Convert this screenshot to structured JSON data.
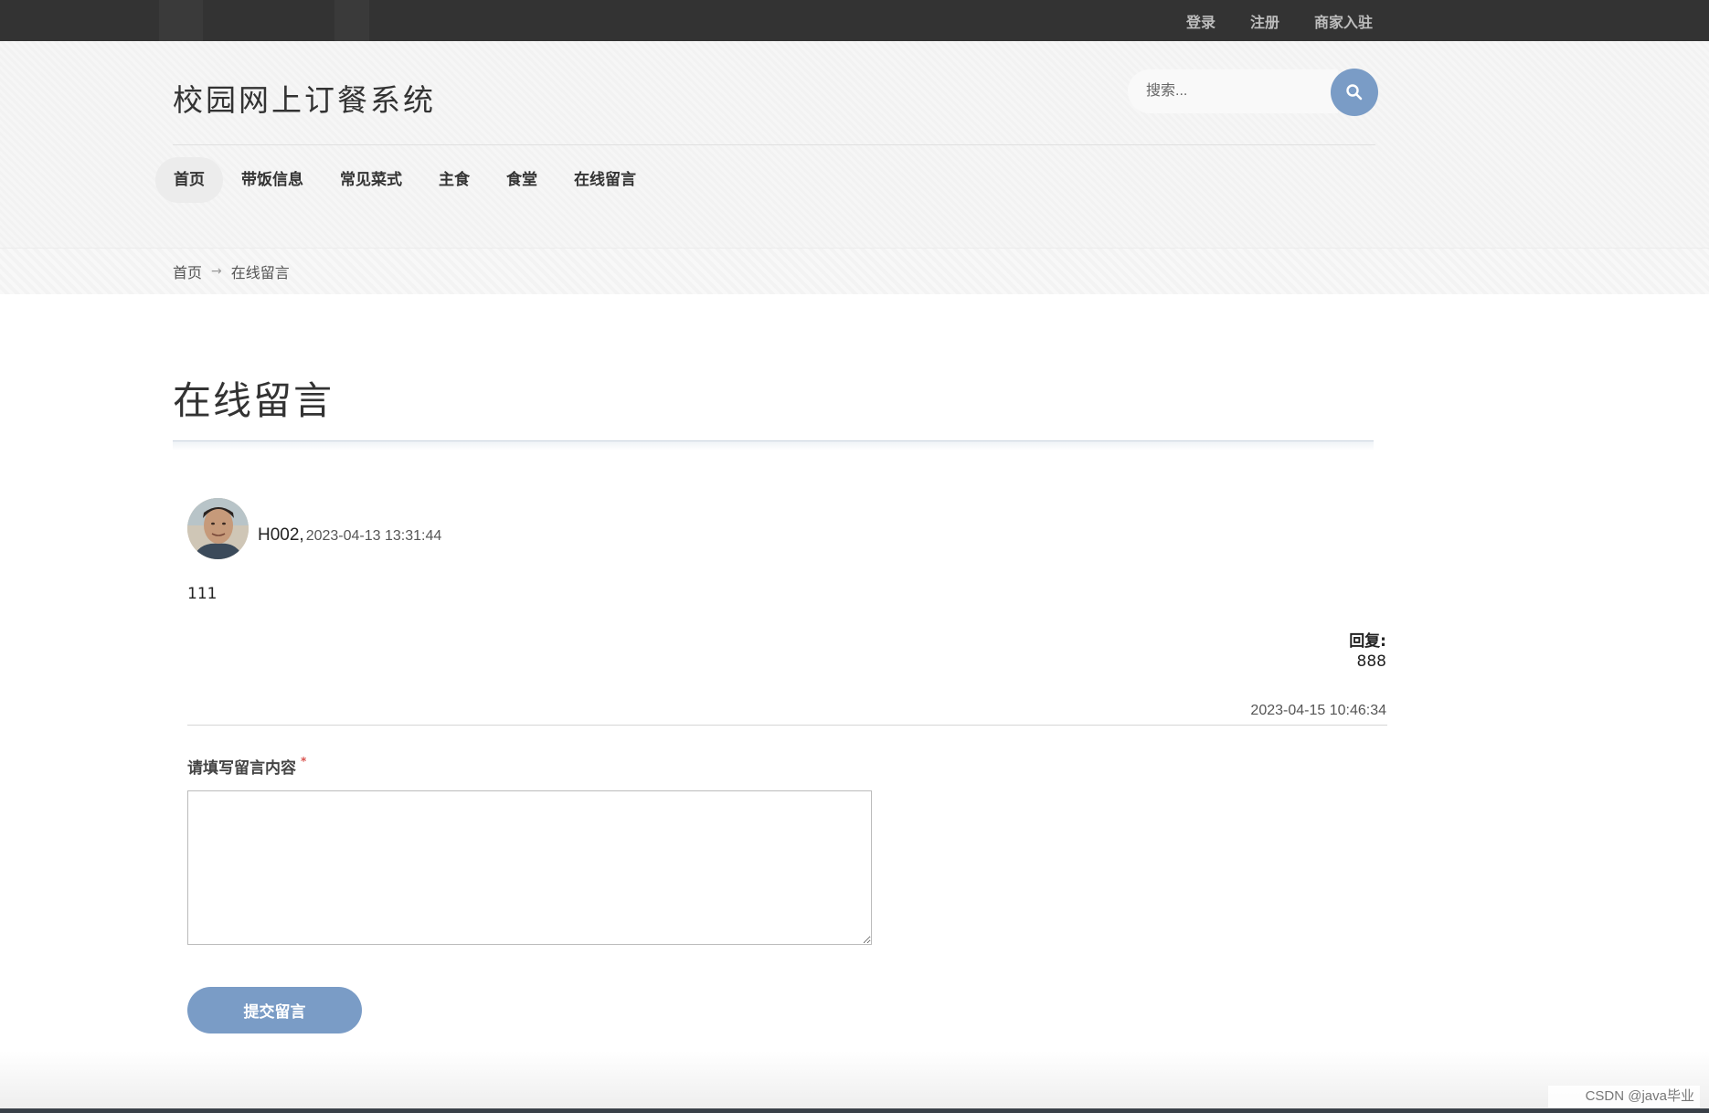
{
  "topbar": {
    "links": [
      "登录",
      "注册",
      "商家入驻"
    ]
  },
  "header": {
    "site_title": "校园网上订餐系统",
    "search_placeholder": "搜索...",
    "search_icon": "search-icon"
  },
  "nav": {
    "items": [
      "首页",
      "带饭信息",
      "常见菜式",
      "主食",
      "食堂",
      "在线留言"
    ],
    "active": "首页"
  },
  "breadcrumb": {
    "home": "首页",
    "separator": "→",
    "current": "在线留言"
  },
  "page": {
    "title": "在线留言"
  },
  "messages": [
    {
      "avatar": "user-avatar",
      "user": "H002,",
      "time": "2023-04-13 13:31:44",
      "content": "111",
      "reply_label": "回复:",
      "reply_content": "888",
      "reply_time": "2023-04-15 10:46:34"
    }
  ],
  "form": {
    "label": "请填写留言内容",
    "required_mark": "*",
    "textarea_value": "",
    "submit_label": "提交留言"
  },
  "watermark": "CSDN @java毕业",
  "colors": {
    "topbar": "#333333",
    "accent": "#7a9cc6"
  }
}
